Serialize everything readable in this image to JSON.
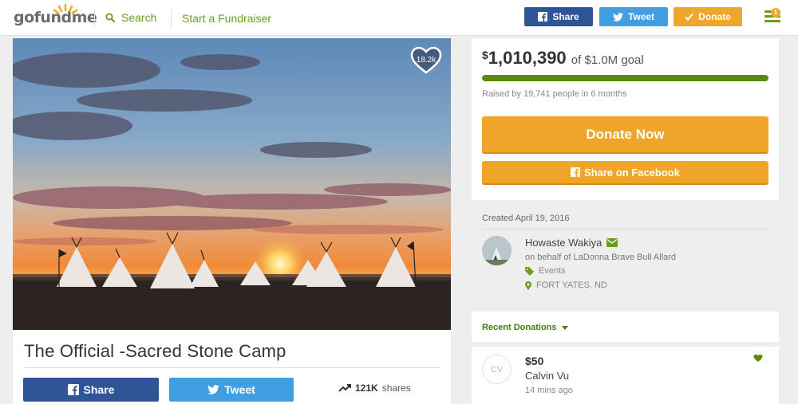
{
  "header": {
    "logo_go": "go",
    "logo_fund": "fund",
    "logo_me": "me",
    "search_label": "Search",
    "start_label": "Start a Fundraiser",
    "share_label": "Share",
    "tweet_label": "Tweet",
    "donate_label": "Donate",
    "menu_badge": "1"
  },
  "campaign": {
    "title": "The Official -Sacred Stone Camp",
    "heart_count": "18.2k",
    "share_label": "Share",
    "tweet_label": "Tweet",
    "shares_count": "121K",
    "shares_suffix": "shares"
  },
  "goal": {
    "dollar_sign": "$",
    "amount": "1,010,390",
    "of_goal": "of $1.0M goal",
    "progress_fraction": 1.0,
    "raised_text": "Raised by 19,741 people in 6 months",
    "donate_now_label": "Donate Now",
    "share_facebook_label": "Share on Facebook"
  },
  "organizer": {
    "created": "Created April 19, 2016",
    "name": "Howaste Wakiya",
    "on_behalf": "on behalf of LaDonna Brave Bull Allard",
    "category": "Events",
    "location": "FORT YATES, ND"
  },
  "recent": {
    "label": "Recent Donations"
  },
  "donations": [
    {
      "initials": "CV",
      "amount": "$50",
      "name": "Calvin Vu",
      "time": "14 mins ago"
    }
  ],
  "colors": {
    "green": "#6a9e1f",
    "facebook": "#2f5597",
    "twitter": "#3f9fe2",
    "orange": "#eea52a"
  }
}
